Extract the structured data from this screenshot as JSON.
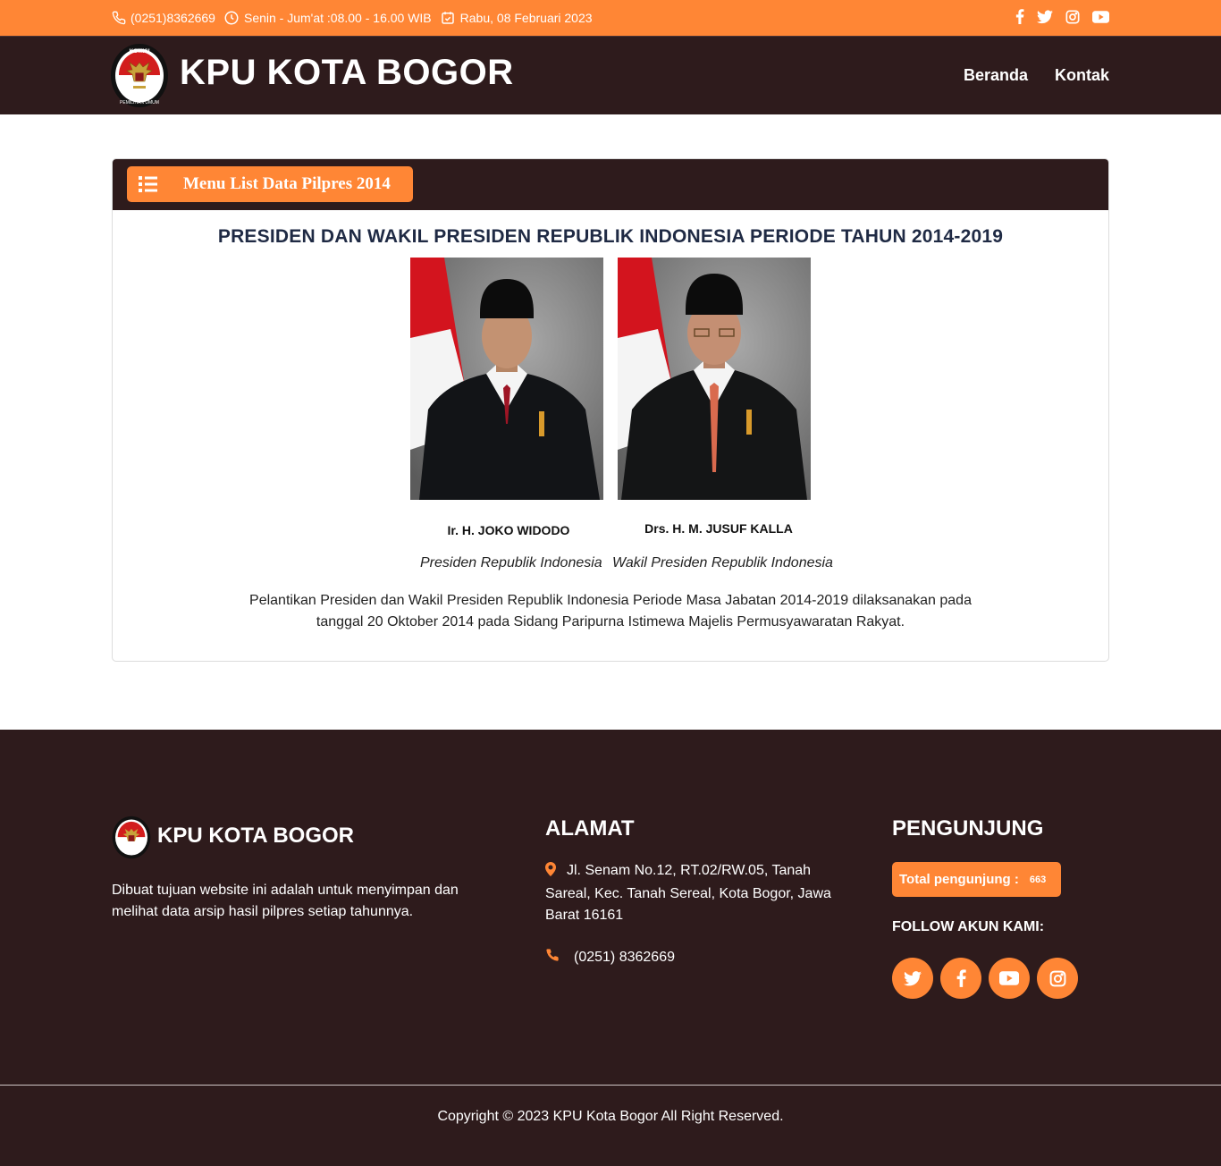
{
  "topbar": {
    "phone": "(0251)8362669",
    "hours": "Senin - Jum'at :08.00 - 16.00 WIB",
    "date": "Rabu, 08 Februari 2023",
    "social_icons": [
      "facebook-icon",
      "twitter-icon",
      "instagram-icon",
      "youtube-icon"
    ]
  },
  "navbar": {
    "brand": "KPU KOTA BOGOR",
    "logo_text_top": "KOMISI",
    "logo_text_bottom": "PEMILIHAN UMUM",
    "menu": [
      {
        "label": "Beranda"
      },
      {
        "label": "Kontak"
      }
    ]
  },
  "card": {
    "menu_button_label": "Menu List Data Pilpres 2014",
    "title": "PRESIDEN DAN WAKIL PRESIDEN REPUBLIK INDONESIA PERIODE TAHUN 2014-2019",
    "candidates": [
      {
        "name": "Ir. H. JOKO WIDODO",
        "role": "Presiden Republik Indonesia"
      },
      {
        "name": "Drs. H. M. JUSUF KALLA",
        "role": "Wakil Presiden Republik Indonesia"
      }
    ],
    "description_line1": "Pelantikan Presiden dan Wakil Presiden Republik Indonesia Periode Masa Jabatan 2014-2019 dilaksanakan pada",
    "description_line2": "tanggal 20 Oktober 2014 pada Sidang Paripurna Istimewa Majelis Permusyawaratan Rakyat."
  },
  "footer": {
    "brand": "KPU KOTA BOGOR",
    "about": "Dibuat tujuan website ini adalah untuk menyimpan dan melihat data arsip hasil pilpres setiap tahunnya.",
    "address_heading": "ALAMAT",
    "address": "Jl. Senam No.12, RT.02/RW.05, Tanah Sareal, Kec. Tanah Sereal, Kota Bogor, Jawa Barat 16161",
    "phone": "(0251) 8362669",
    "visitors_heading": "PENGUNJUNG",
    "visitors_label": "Total pengunjung :",
    "visitors_count": "663",
    "follow_label": "FOLLOW AKUN KAMI:",
    "follow_icons": [
      "twitter-icon",
      "facebook-icon",
      "youtube-icon",
      "instagram-icon"
    ],
    "copyright": "Copyright © 2023 KPU Kota Bogor All Right Reserved."
  },
  "colors": {
    "accent": "#ff8635",
    "dark": "#2e1b1c",
    "title": "#1f2a44"
  }
}
